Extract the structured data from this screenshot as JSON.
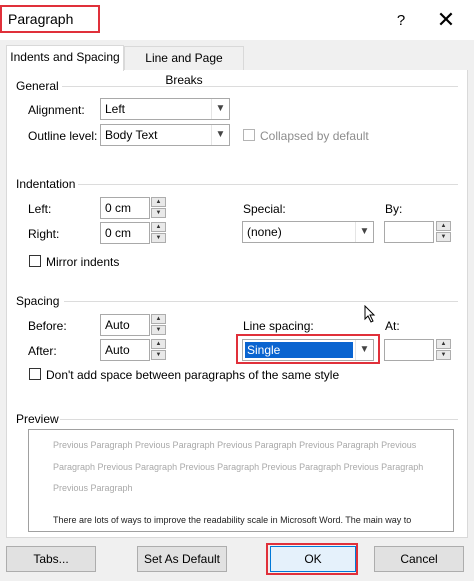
{
  "window": {
    "title": "Paragraph",
    "help": "?",
    "close": "✕"
  },
  "tabs": [
    {
      "label": "Indents and Spacing",
      "active": true
    },
    {
      "label": "Line and Page Breaks",
      "active": false
    }
  ],
  "general": {
    "title": "General",
    "alignment_label": "Alignment:",
    "alignment_value": "Left",
    "outline_label": "Outline level:",
    "outline_value": "Body Text",
    "collapsed_label": "Collapsed by default"
  },
  "indentation": {
    "title": "Indentation",
    "left_label": "Left:",
    "left_value": "0 cm",
    "right_label": "Right:",
    "right_value": "0 cm",
    "special_label": "Special:",
    "special_value": "(none)",
    "by_label": "By:",
    "by_value": "",
    "mirror_label": "Mirror indents"
  },
  "spacing": {
    "title": "Spacing",
    "before_label": "Before:",
    "before_value": "Auto",
    "after_label": "After:",
    "after_value": "Auto",
    "line_spacing_label": "Line spacing:",
    "line_spacing_value": "Single",
    "at_label": "At:",
    "at_value": "",
    "dont_add_label": "Don't add space between paragraphs of the same style"
  },
  "preview": {
    "title": "Preview",
    "line1": "Previous Paragraph Previous Paragraph Previous Paragraph Previous Paragraph Previous",
    "line2": "Paragraph Previous Paragraph Previous Paragraph Previous Paragraph Previous Paragraph",
    "line3": "Previous Paragraph",
    "sample": "There are lots of ways to improve the readability scale in Microsoft Word. The main way to"
  },
  "buttons": {
    "tabs": "Tabs...",
    "set_default": "Set As Default",
    "ok": "OK",
    "cancel": "Cancel"
  },
  "colors": {
    "highlight_border": "#e0303a",
    "selection": "#0a64d0"
  }
}
